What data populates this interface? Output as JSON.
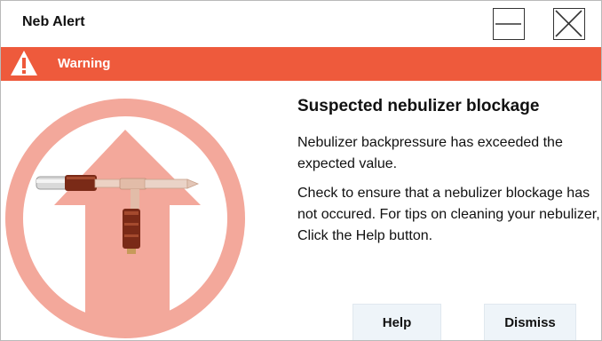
{
  "window": {
    "title": "Neb Alert",
    "minimize_icon": "minimize-icon",
    "close_icon": "close-icon"
  },
  "banner": {
    "icon": "warning-triangle-icon",
    "label": "Warning",
    "color": "#ee5a3c"
  },
  "illustration": {
    "icon": "upward-arrow-icon",
    "image": "nebulizer-image",
    "color": "#f3a89b"
  },
  "message": {
    "heading": "Suspected nebulizer blockage",
    "paragraph1": "Nebulizer backpressure has exceeded the expected value.",
    "paragraph2": "Check to ensure that a nebulizer blockage has not occured. For tips on cleaning your nebulizer, Click the Help button."
  },
  "buttons": {
    "help_label": "Help",
    "dismiss_label": "Dismiss",
    "background": "#eef4f9"
  }
}
